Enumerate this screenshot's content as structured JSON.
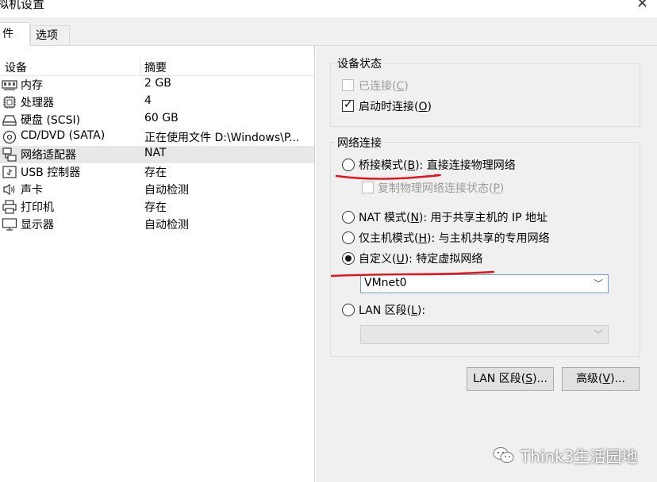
{
  "window": {
    "title": "拟机设置",
    "close_glyph": "✕"
  },
  "tabs": [
    {
      "label": "硬件",
      "visible_label": "件",
      "active": true
    },
    {
      "label": "选项",
      "active": false
    }
  ],
  "device_list": {
    "columns": {
      "device": "设备",
      "summary": "摘要"
    },
    "rows": [
      {
        "icon": "memory-icon",
        "name": "内存",
        "summary": "2 GB"
      },
      {
        "icon": "processor-icon",
        "name": "处理器",
        "summary": "4"
      },
      {
        "icon": "hard-disk-icon",
        "name": "硬盘 (SCSI)",
        "summary": "60 GB"
      },
      {
        "icon": "cd-dvd-icon",
        "name": "CD/DVD (SATA)",
        "summary": "正在使用文件 D:\\Windows\\P..."
      },
      {
        "icon": "network-adapter-icon",
        "name": "网络适配器",
        "summary": "NAT",
        "selected": true
      },
      {
        "icon": "usb-icon",
        "name": "USB 控制器",
        "summary": "存在"
      },
      {
        "icon": "sound-icon",
        "name": "声卡",
        "summary": "自动检测"
      },
      {
        "icon": "printer-icon",
        "name": "打印机",
        "summary": "存在"
      },
      {
        "icon": "display-icon",
        "name": "显示器",
        "summary": "自动检测"
      }
    ]
  },
  "device_status": {
    "legend": "设备状态",
    "connected": {
      "text": "已连接(",
      "key": "C",
      "close": ")",
      "checked": false,
      "enabled": false
    },
    "connect_at_power_on": {
      "text": "启动时连接(",
      "key": "O",
      "close": ")",
      "checked": true,
      "enabled": true
    }
  },
  "network_connection": {
    "legend": "网络连接",
    "bridged": {
      "text": "桥接模式(",
      "key": "B",
      "rest": "): 直接连接物理网络",
      "selected": false
    },
    "replicate": {
      "text": "复制物理网络连接状态(",
      "key": "P",
      "close": ")",
      "checked": false,
      "enabled": false
    },
    "nat": {
      "text": "NAT 模式(",
      "key": "N",
      "rest": "): 用于共享主机的 IP 地址",
      "selected": false
    },
    "host_only": {
      "text": "仅主机模式(",
      "key": "H",
      "rest": "): 与主机共享的专用网络",
      "selected": false
    },
    "custom": {
      "text": "自定义(",
      "key": "U",
      "rest": "): 特定虚拟网络",
      "selected": true
    },
    "custom_network_value": "VMnet0",
    "lan_segment": {
      "text": "LAN 区段(",
      "key": "L",
      "rest": "):",
      "selected": false
    },
    "lan_segment_value": ""
  },
  "buttons": {
    "lan_segments": {
      "text": "LAN 区段(",
      "key": "S",
      "rest": ")..."
    },
    "advanced": {
      "text": "高级(",
      "key": "V",
      "rest": ")..."
    }
  },
  "watermark": "Think3生活园地",
  "colors": {
    "annotation_red": "#e0141e",
    "select_border": "#7a9cd3",
    "selected_row": "#e8e8e8"
  }
}
